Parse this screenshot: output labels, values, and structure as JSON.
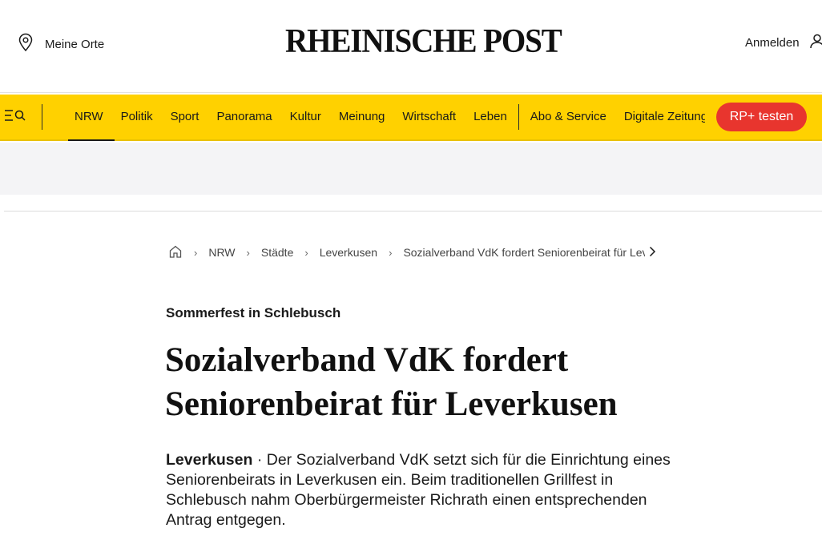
{
  "header": {
    "my_places_label": "Meine Orte",
    "logo_text": "RHEINISCHE POST",
    "login_label": "Anmelden"
  },
  "nav": {
    "items": [
      {
        "label": "NRW",
        "active": true
      },
      {
        "label": "Politik"
      },
      {
        "label": "Sport"
      },
      {
        "label": "Panorama"
      },
      {
        "label": "Kultur"
      },
      {
        "label": "Meinung"
      },
      {
        "label": "Wirtschaft"
      },
      {
        "label": "Leben"
      }
    ],
    "service_items": [
      {
        "label": "Abo & Service"
      },
      {
        "label": "Digitale Zeitung"
      }
    ],
    "cta_label": "RP+ testen"
  },
  "breadcrumb": {
    "items": [
      "NRW",
      "Städte",
      "Leverkusen"
    ],
    "current": "Sozialverband VdK fordert Seniorenbeirat für Leverkusen"
  },
  "article": {
    "kicker": "Sommerfest in Schlebusch",
    "headline": "Sozialverband VdK fordert Seniorenbeirat für Leverkusen",
    "dateline": "Leverkusen",
    "separator": " · ",
    "lead": "Der Sozialverband VdK setzt sich für die Einrichtung eines Seniorenbeirats in Leverkusen ein. Beim traditionellen Grillfest in Schlebusch nahm Oberbürgermeister Richrath einen entsprechenden Antrag entgegen."
  },
  "colors": {
    "brand_yellow": "#ffd100",
    "cta_red": "#e8352e",
    "ad_background": "#f4f4f6"
  },
  "icons": {
    "my_places": "location-pin-icon",
    "login": "user-icon",
    "menu": "menu-search-icon",
    "home": "home-icon",
    "chevron": "chevron-right-icon"
  }
}
